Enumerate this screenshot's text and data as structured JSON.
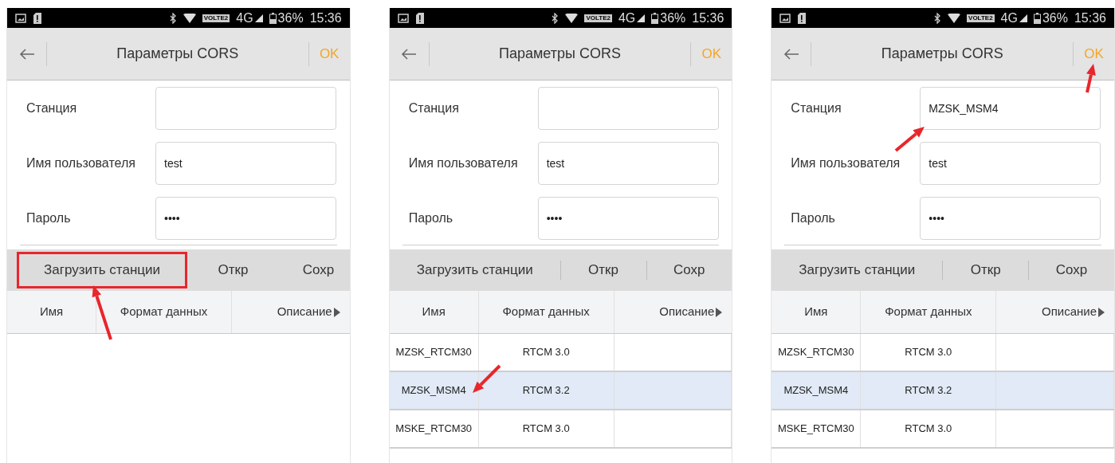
{
  "panels": [
    {
      "status_bar": {
        "volte": "VOLTE2",
        "network": "4G",
        "battery": "36%",
        "time": "15:36"
      },
      "header": {
        "title": "Параметры CORS",
        "ok": "OK",
        "ok_pointed": false
      },
      "fields": [
        {
          "label": "Станция",
          "pointed": false
        },
        {
          "label": "Имя пользователя",
          "value": "test",
          "pointed": false
        },
        {
          "label": "Пароль",
          "value": "••••",
          "pointed": false
        }
      ],
      "toolbar": [
        {
          "label": "Загрузить станции",
          "outlined": true,
          "pointed": true
        },
        {
          "label": "Откр",
          "outlined": false,
          "pointed": false
        },
        {
          "label": "Сохр",
          "outlined": false,
          "pointed": false
        }
      ],
      "table": {
        "columns": [
          "Имя",
          "Формат данных",
          "Описание"
        ]
      }
    },
    {
      "status_bar": {
        "volte": "VOLTE2",
        "network": "4G",
        "battery": "36%",
        "time": "15:36"
      },
      "header": {
        "title": "Параметры CORS",
        "ok": "OK",
        "ok_pointed": false
      },
      "fields": [
        {
          "label": "Станция",
          "pointed": false
        },
        {
          "label": "Имя пользователя",
          "value": "test",
          "pointed": false
        },
        {
          "label": "Пароль",
          "value": "••••",
          "pointed": false
        }
      ],
      "toolbar": [
        {
          "label": "Загрузить станции",
          "outlined": false,
          "pointed": false
        },
        {
          "label": "Откр",
          "outlined": false,
          "pointed": false
        },
        {
          "label": "Сохр",
          "outlined": false,
          "pointed": false
        }
      ],
      "table": {
        "columns": [
          "Имя",
          "Формат данных",
          "Описание"
        ],
        "rows": [
          {
            "cells": [
              "MZSK_RTCM30",
              "RTCM 3.0"
            ],
            "selected": false,
            "pointed": false
          },
          {
            "cells": [
              "MZSK_MSM4",
              "RTCM 3.2"
            ],
            "selected": true,
            "pointed": true
          },
          {
            "cells": [
              "MSKE_RTCM30",
              "RTCM 3.0"
            ],
            "selected": false,
            "pointed": false
          }
        ]
      }
    },
    {
      "status_bar": {
        "volte": "VOLTE2",
        "network": "4G",
        "battery": "36%",
        "time": "15:36"
      },
      "header": {
        "title": "Параметры CORS",
        "ok": "OK",
        "ok_pointed": true
      },
      "fields": [
        {
          "label": "Станция",
          "value": "MZSK_MSM4",
          "pointed": true
        },
        {
          "label": "Имя пользователя",
          "value": "test",
          "pointed": false
        },
        {
          "label": "Пароль",
          "value": "••••",
          "pointed": false
        }
      ],
      "toolbar": [
        {
          "label": "Загрузить станции",
          "outlined": false,
          "pointed": false
        },
        {
          "label": "Откр",
          "outlined": false,
          "pointed": false
        },
        {
          "label": "Сохр",
          "outlined": false,
          "pointed": false
        }
      ],
      "table": {
        "columns": [
          "Имя",
          "Формат данных",
          "Описание"
        ],
        "rows": [
          {
            "cells": [
              "MZSK_RTCM30",
              "RTCM 3.0"
            ],
            "selected": false,
            "pointed": false
          },
          {
            "cells": [
              "MZSK_MSM4",
              "RTCM 3.2"
            ],
            "selected": true,
            "pointed": false
          },
          {
            "cells": [
              "MSKE_RTCM30",
              "RTCM 3.0"
            ],
            "selected": false,
            "pointed": false
          }
        ]
      }
    }
  ]
}
